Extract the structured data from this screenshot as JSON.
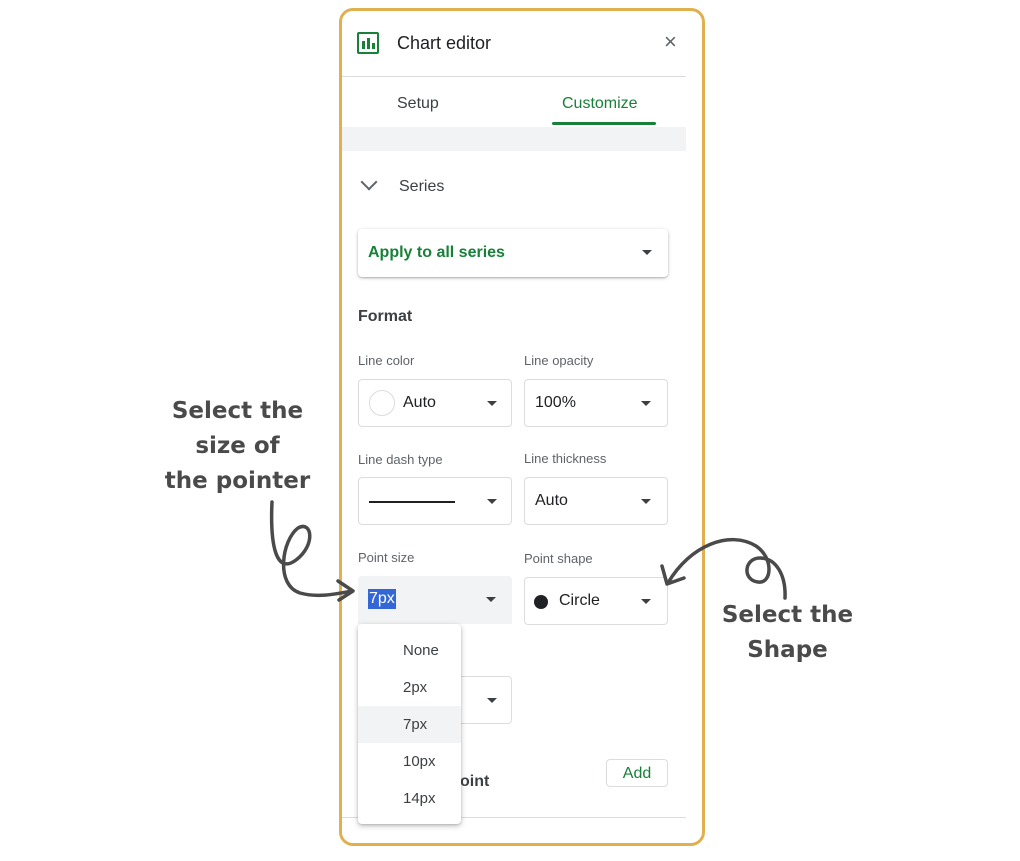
{
  "header": {
    "title": "Chart editor",
    "close": "×"
  },
  "tabs": [
    {
      "label": "Setup"
    },
    {
      "label": "Customize"
    }
  ],
  "series_section": {
    "label": "Series"
  },
  "apply_dropdown": {
    "value": "Apply to all series"
  },
  "format": {
    "heading": "Format",
    "line_color": {
      "label": "Line color",
      "value": "Auto"
    },
    "line_opacity": {
      "label": "Line opacity",
      "value": "100%"
    },
    "line_dash_type": {
      "label": "Line dash type"
    },
    "line_thickness": {
      "label": "Line thickness",
      "value": "Auto"
    },
    "point_size": {
      "label": "Point size",
      "value": "7px"
    },
    "point_shape": {
      "label": "Point shape",
      "value": "Circle"
    }
  },
  "point_size_menu": {
    "items": [
      "None",
      "2px",
      "7px",
      "10px",
      "14px"
    ],
    "selected": "7px"
  },
  "data_point": {
    "label_fragment": "oint",
    "add_label": "Add"
  },
  "annotations": {
    "left_line1": "Select the",
    "left_line2": "size of",
    "left_line3": "the pointer",
    "right": "Select the Shape"
  },
  "colors": {
    "accent": "#188038",
    "frame": "#e0b04f",
    "selection": "#3367d6"
  }
}
